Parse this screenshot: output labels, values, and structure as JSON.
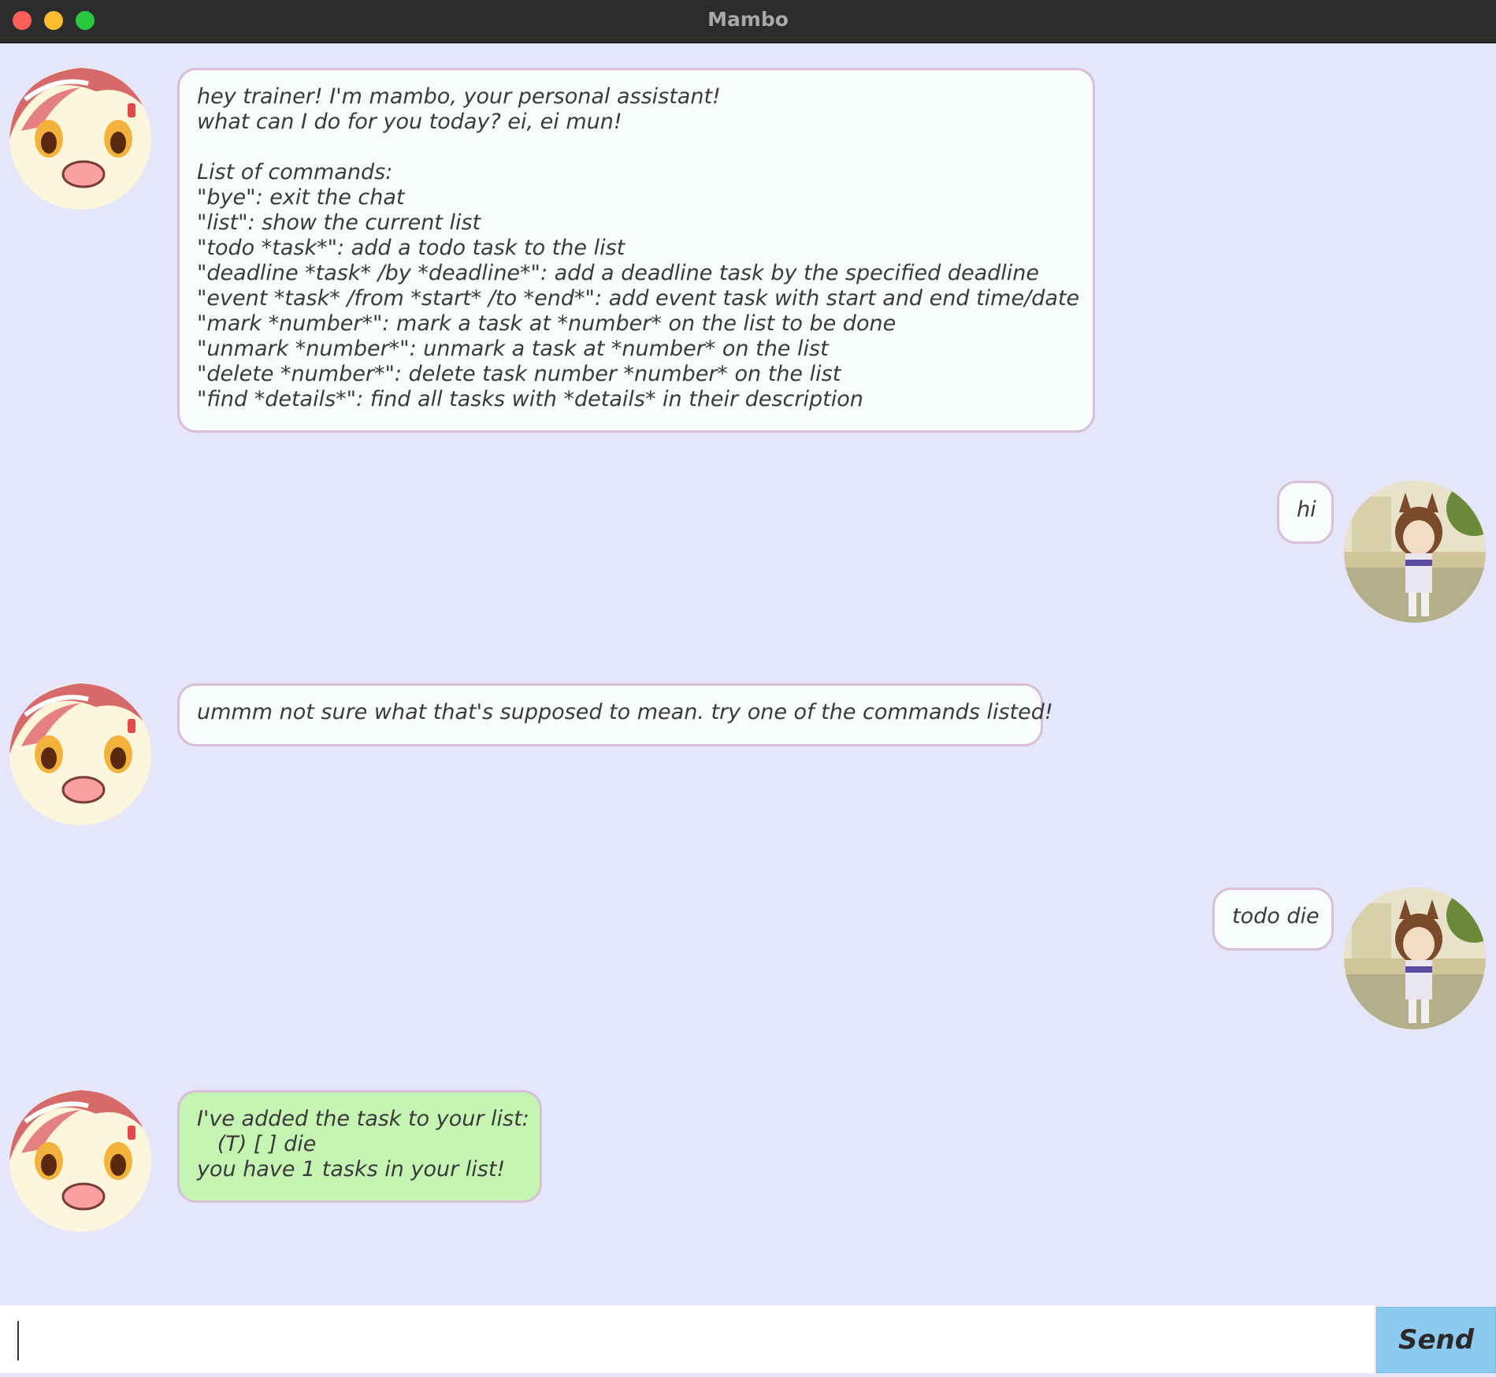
{
  "window": {
    "title": "Mambo"
  },
  "messages": [
    {
      "sender": "bot",
      "text": "hey trainer! I'm mambo, your personal assistant!\nwhat can I do for you today? ei, ei mun!\n\nList of commands:\n\"bye\": exit the chat\n\"list\": show the current list\n\"todo *task*\": add a todo task to the list\n\"deadline *task* /by *deadline*\": add a deadline task by the specified deadline\n\"event *task* /from *start* /to *end*\": add event task with start and end time/date\n\"mark *number*\": mark a task at *number* on the list to be done\n\"unmark *number*\": unmark a task at *number* on the list\n\"delete *number*\": delete task number *number* on the list\n\"find *details*\": find all tasks with *details* in their description"
    },
    {
      "sender": "user",
      "text": "hi"
    },
    {
      "sender": "bot",
      "text": "ummm not sure what that's supposed to mean. try one of the commands listed!"
    },
    {
      "sender": "user",
      "text": "todo die"
    },
    {
      "sender": "bot",
      "text": "I've added the task to your list:\n   (T) [ ] die\nyou have 1 tasks in your list!"
    }
  ],
  "input": {
    "value": "",
    "placeholder": ""
  },
  "send_label": "Send",
  "colors": {
    "background": "#e6e6fa",
    "bubble": "#f8fcfd",
    "bubble_border": "#d8bfd8",
    "success_bubble": "#c6f4b3",
    "send_button": "#8ccbef"
  }
}
